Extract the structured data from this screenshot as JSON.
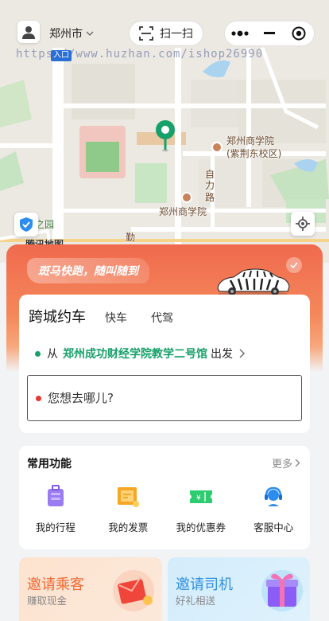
{
  "header": {
    "city": "郑州市",
    "scan_label": "扫一扫"
  },
  "map": {
    "watermark": "https://www.huzhan.com/ishop26990",
    "entry_badge": "入口",
    "poi_1": "郑州商学院",
    "poi_1_sub": "(紫荆东校区)",
    "poi_2": "郑州商学院",
    "road": "自力路",
    "road_2": "勤",
    "park_label": "之园",
    "tencent": "腾讯地图"
  },
  "banner": {
    "slogan": "斑马快跑，随叫随到"
  },
  "booking": {
    "tabs": [
      "跨城约车",
      "快车",
      "代驾"
    ],
    "from_prefix": "从",
    "from_place": "郑州成功财经学院教学二号馆",
    "from_suffix": "出发",
    "destination_placeholder": "您想去哪儿?"
  },
  "functions": {
    "title": "常用功能",
    "more": "更多",
    "items": [
      {
        "label": "我的行程",
        "icon": "luggage-icon",
        "color": "#8e6ee8"
      },
      {
        "label": "我的发票",
        "icon": "invoice-icon",
        "color": "#f5a623"
      },
      {
        "label": "我的优惠券",
        "icon": "coupon-icon",
        "color": "#2ecc71"
      },
      {
        "label": "客服中心",
        "icon": "headset-icon",
        "color": "#2d8cf0"
      }
    ]
  },
  "invites": [
    {
      "title": "邀请乘客",
      "subtitle": "赚取现金"
    },
    {
      "title": "邀请司机",
      "subtitle": "好礼相送"
    }
  ],
  "colors": {
    "brand_orange": "#f06a4e",
    "green": "#18a06a",
    "red_dot": "#e8392f"
  }
}
